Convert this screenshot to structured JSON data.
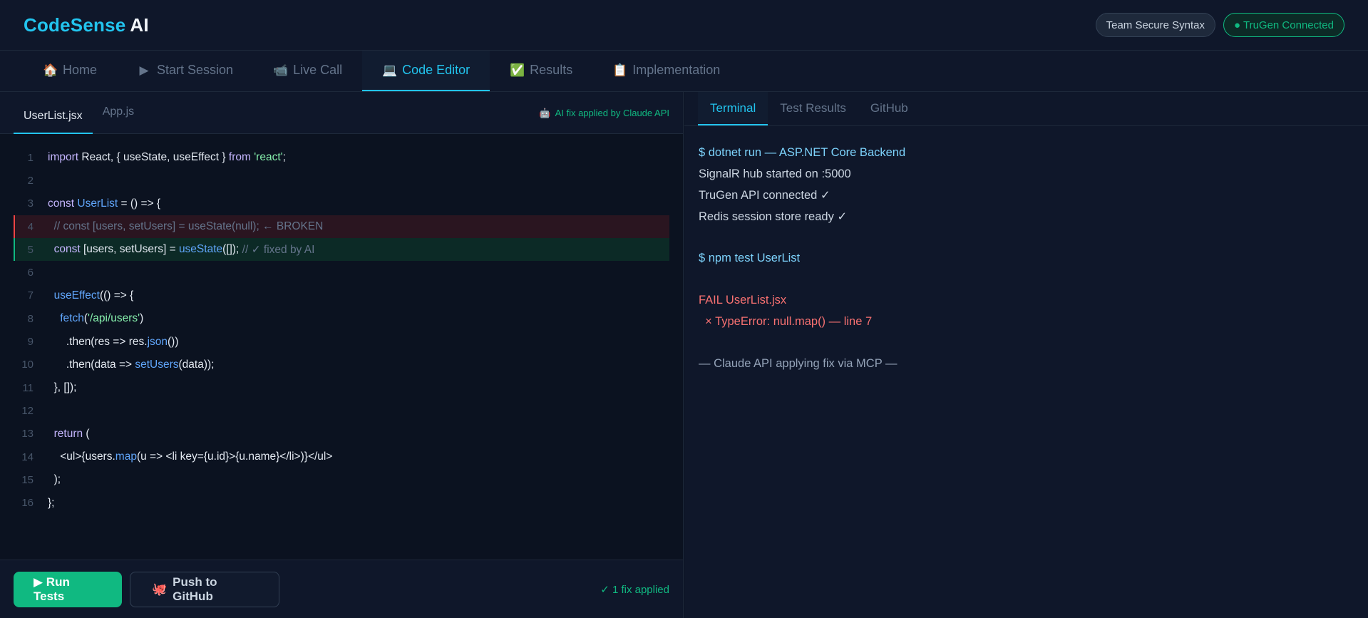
{
  "header": {
    "brand": "CodeSense",
    "brand_suffix": "AI",
    "team_label": "Team Secure Syntax",
    "connection_label": "● TruGen Connected"
  },
  "nav": {
    "tabs": [
      {
        "icon": "🏠",
        "icon_name": "home-icon",
        "label": "Home"
      },
      {
        "icon": "▶",
        "icon_name": "play-icon",
        "label": "Start Session"
      },
      {
        "icon": "📹",
        "icon_name": "video-camera-icon",
        "label": "Live Call"
      },
      {
        "icon": "💻",
        "icon_name": "laptop-icon",
        "label": "Code Editor"
      },
      {
        "icon": "✅",
        "icon_name": "check-box-icon",
        "label": "Results"
      },
      {
        "icon": "📋",
        "icon_name": "clipboard-icon",
        "label": "Implementation"
      }
    ],
    "active": "Code Editor"
  },
  "editor": {
    "files": [
      "UserList.jsx",
      "App.js"
    ],
    "active_file": "UserList.jsx",
    "ai_note_icon": "🤖",
    "ai_note": "AI fix applied by Claude API",
    "line_numbers": [
      "1",
      "2",
      "3",
      "4",
      "5",
      "6",
      "7",
      "8",
      "9",
      "10",
      "11",
      "12",
      "13",
      "14",
      "15",
      "16"
    ],
    "code": {
      "l1_a": "import",
      "l1_b": " React, { useState, useEffect } ",
      "l1_c": "from",
      "l1_d": " 'react'",
      "l1_e": ";",
      "l3_a": "const",
      "l3_b": " UserList",
      "l3_c": " = () => {",
      "l4": "  // const [users, setUsers] = useState(null); ← BROKEN",
      "l5_a": "  const",
      "l5_b": " [users, setUsers] = ",
      "l5_c": "useState",
      "l5_d": "([]);",
      "l5_e": " // ✓ fixed by AI",
      "l7_a": "  useEffect",
      "l7_b": "(() => {",
      "l8_a": "    fetch",
      "l8_b": "(",
      "l8_c": "'/api/users'",
      "l8_d": ")",
      "l9_a": "      .then(res => res.",
      "l9_b": "json",
      "l9_c": "())",
      "l10_a": "      .then(data => ",
      "l10_b": "setUsers",
      "l10_c": "(data));",
      "l11": "  }, []);",
      "l13_a": "  return",
      "l13_b": " (",
      "l14_a": "    <ul>{users.",
      "l14_b": "map",
      "l14_c": "(u => <li key={u.id}>{u.name}</li>)}</ul>",
      "l15": "  );",
      "l16": "};"
    },
    "run_button": "▶ Run Tests",
    "push_icon": "🐙",
    "push_button": "Push to GitHub",
    "fix_count": "✓ 1 fix applied"
  },
  "output": {
    "tabs": [
      "Terminal",
      "Test Results",
      "GitHub"
    ],
    "active": "Terminal",
    "lines": {
      "t1": "$ dotnet run — ASP.NET Core Backend",
      "t2": "SignalR hub started on :5000",
      "t3": "TruGen API connected ✓",
      "t4": "Redis session store ready ✓",
      "t6": "$ npm test UserList",
      "t8": "FAIL UserList.jsx",
      "t9": "  × TypeError: null.map() — line 7",
      "t11": "— Claude API applying fix via MCP —"
    }
  },
  "colors": {
    "accent": "#22c4ee",
    "success": "#10b981",
    "error": "#f87171",
    "background": "#0b1220"
  }
}
